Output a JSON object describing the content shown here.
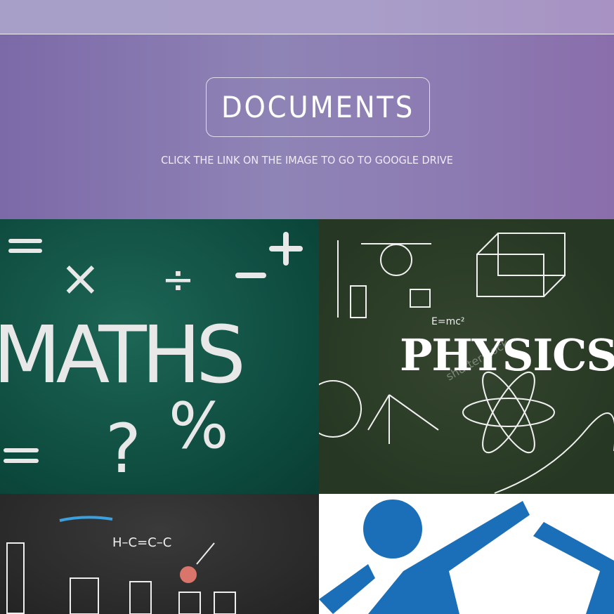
{
  "header": {
    "title": "DOCUMENTS",
    "subtitle": "CLICK THE LINK ON THE IMAGE TO GO TO GOOGLE DRIVE"
  },
  "tiles": [
    {
      "name": "maths",
      "image_text": "MATHS",
      "symbols": [
        "=",
        "×",
        "÷",
        "−",
        "+",
        "?",
        "%",
        "="
      ]
    },
    {
      "name": "physics",
      "image_text": "PHYSICS",
      "formula": "E=mc²",
      "watermark": "shutterstock"
    },
    {
      "name": "chemistry",
      "formula": "H–C=C–C"
    },
    {
      "name": "people"
    }
  ],
  "colors": {
    "hero": "#8f84b6",
    "topbar": "#a89fc8",
    "people_blue": "#1a6fb8"
  }
}
